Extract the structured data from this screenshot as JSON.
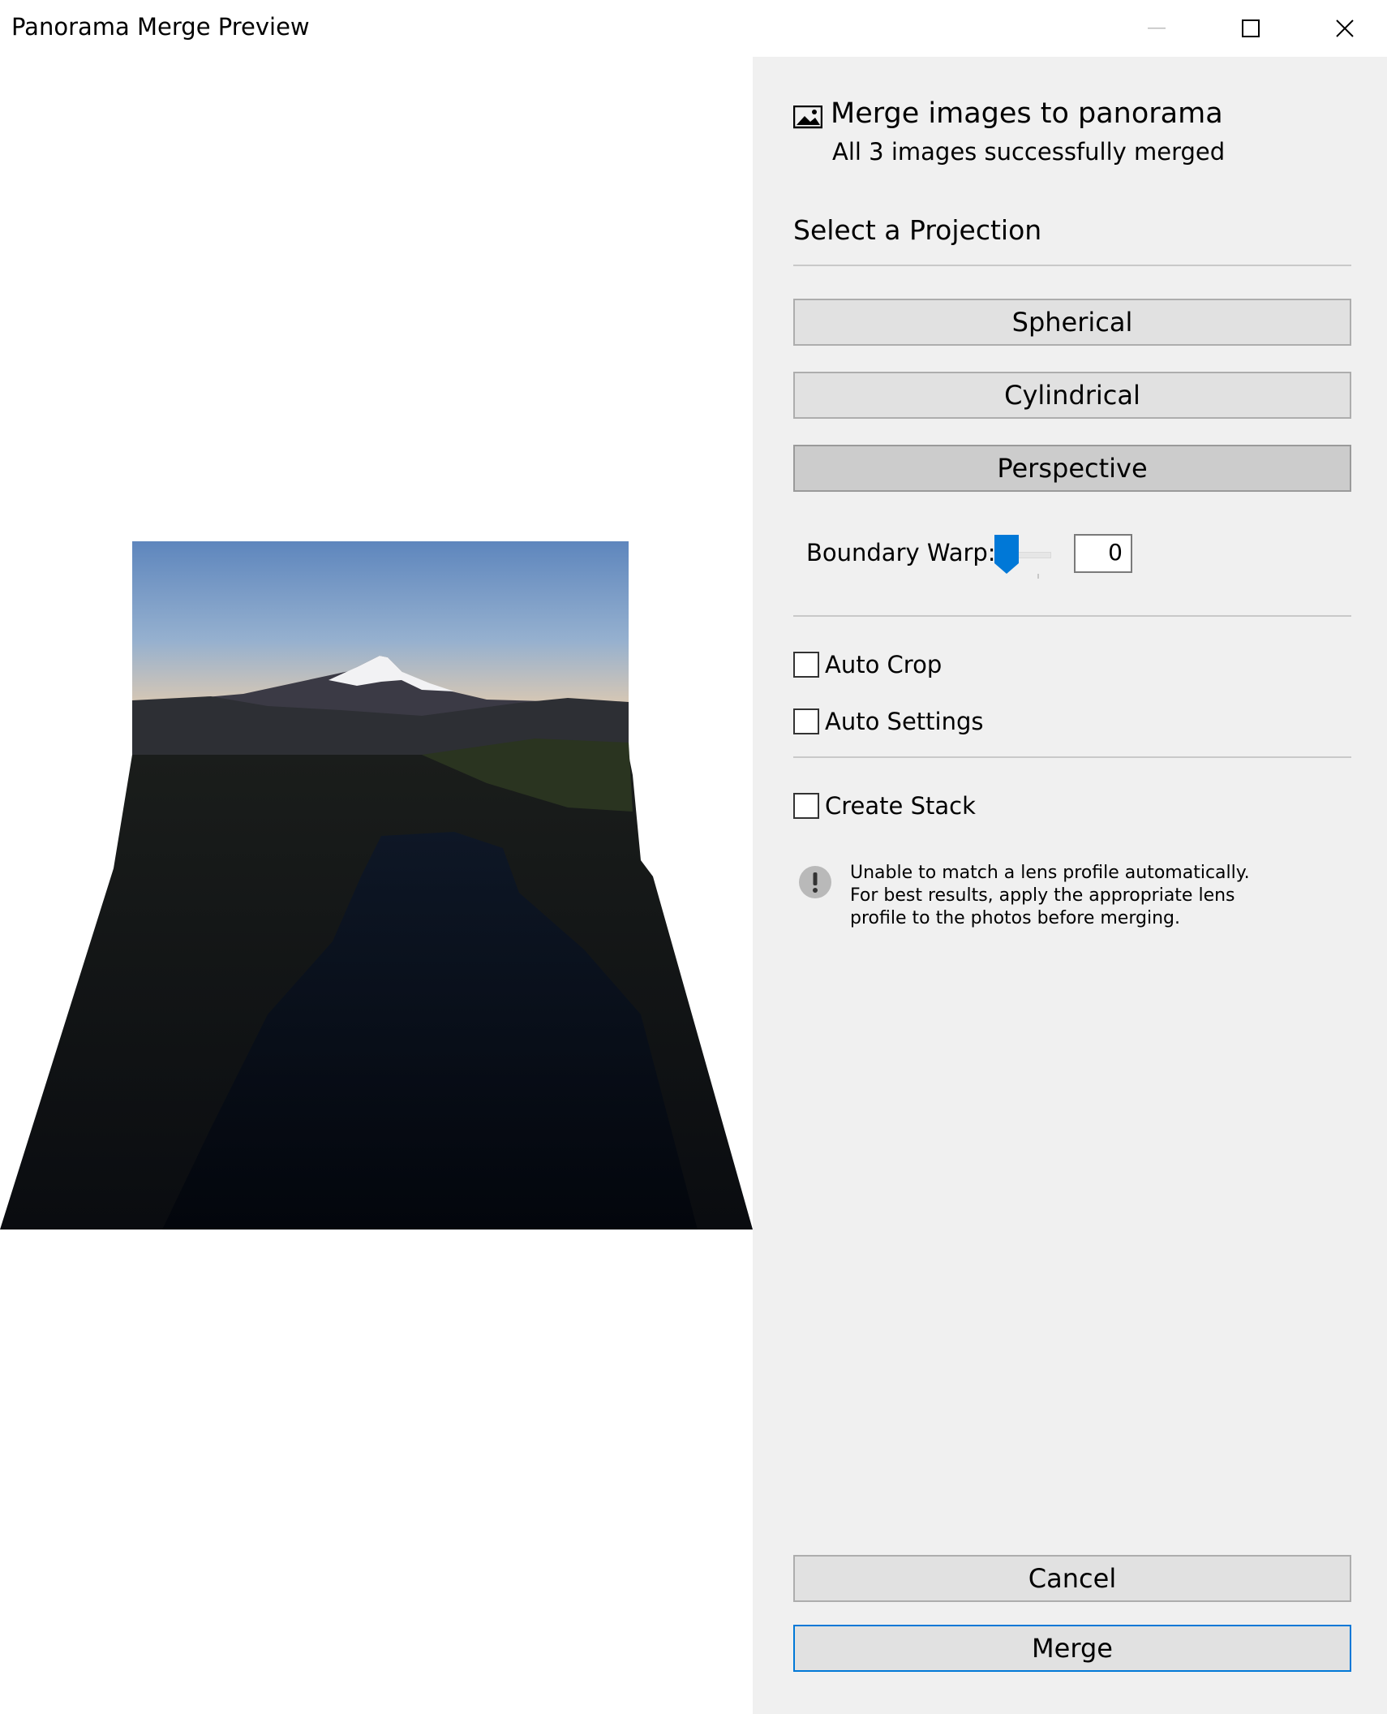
{
  "window": {
    "title": "Panorama Merge Preview"
  },
  "panel": {
    "header_title": "Merge images to panorama",
    "header_subtitle": "All 3 images successfully merged",
    "projection_title": "Select a Projection",
    "projections": [
      {
        "label": "Spherical",
        "selected": false
      },
      {
        "label": "Cylindrical",
        "selected": false
      },
      {
        "label": "Perspective",
        "selected": true
      }
    ],
    "boundary_warp": {
      "label": "Boundary Warp:",
      "value": "0"
    },
    "options": {
      "auto_crop": {
        "label": "Auto Crop",
        "checked": false
      },
      "auto_settings": {
        "label": "Auto Settings",
        "checked": false
      },
      "create_stack": {
        "label": "Create Stack",
        "checked": false
      }
    },
    "warning": "Unable to match a lens profile automatically. For best results, apply the appropriate lens profile to the photos before merging.",
    "buttons": {
      "cancel": "Cancel",
      "merge": "Merge"
    }
  },
  "colors": {
    "accent": "#0078d7",
    "panel_bg": "#f0f0f0",
    "button_bg": "#e1e1e1",
    "selected_bg": "#cccccc"
  },
  "icons": {
    "minimize": "minimize-icon",
    "maximize": "maximize-icon",
    "close": "close-icon",
    "header": "panorama-image-icon",
    "warning": "exclamation-icon"
  }
}
